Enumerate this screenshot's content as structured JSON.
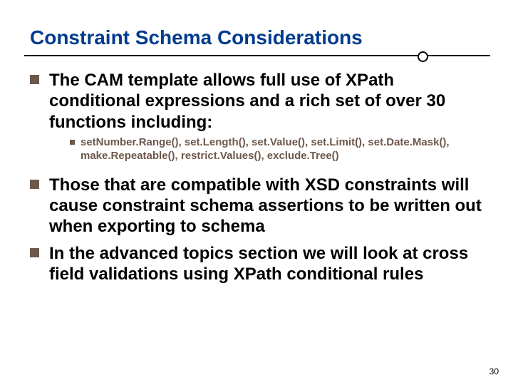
{
  "title": "Constraint Schema Considerations",
  "bullets": {
    "b1": "The CAM template allows full use of XPath conditional expressions and a rich set of over 30 functions including:",
    "b1_sub": "setNumber.Range(), set.Length(), set.Value(), set.Limit(), set.Date.Mask(), make.Repeatable(), restrict.Values(), exclude.Tree()",
    "b2": "Those that are compatible with XSD constraints will cause constraint schema assertions to be written out when exporting to schema",
    "b3": "In the advanced topics section we will look at cross field validations using XPath conditional rules"
  },
  "page_number": "30"
}
